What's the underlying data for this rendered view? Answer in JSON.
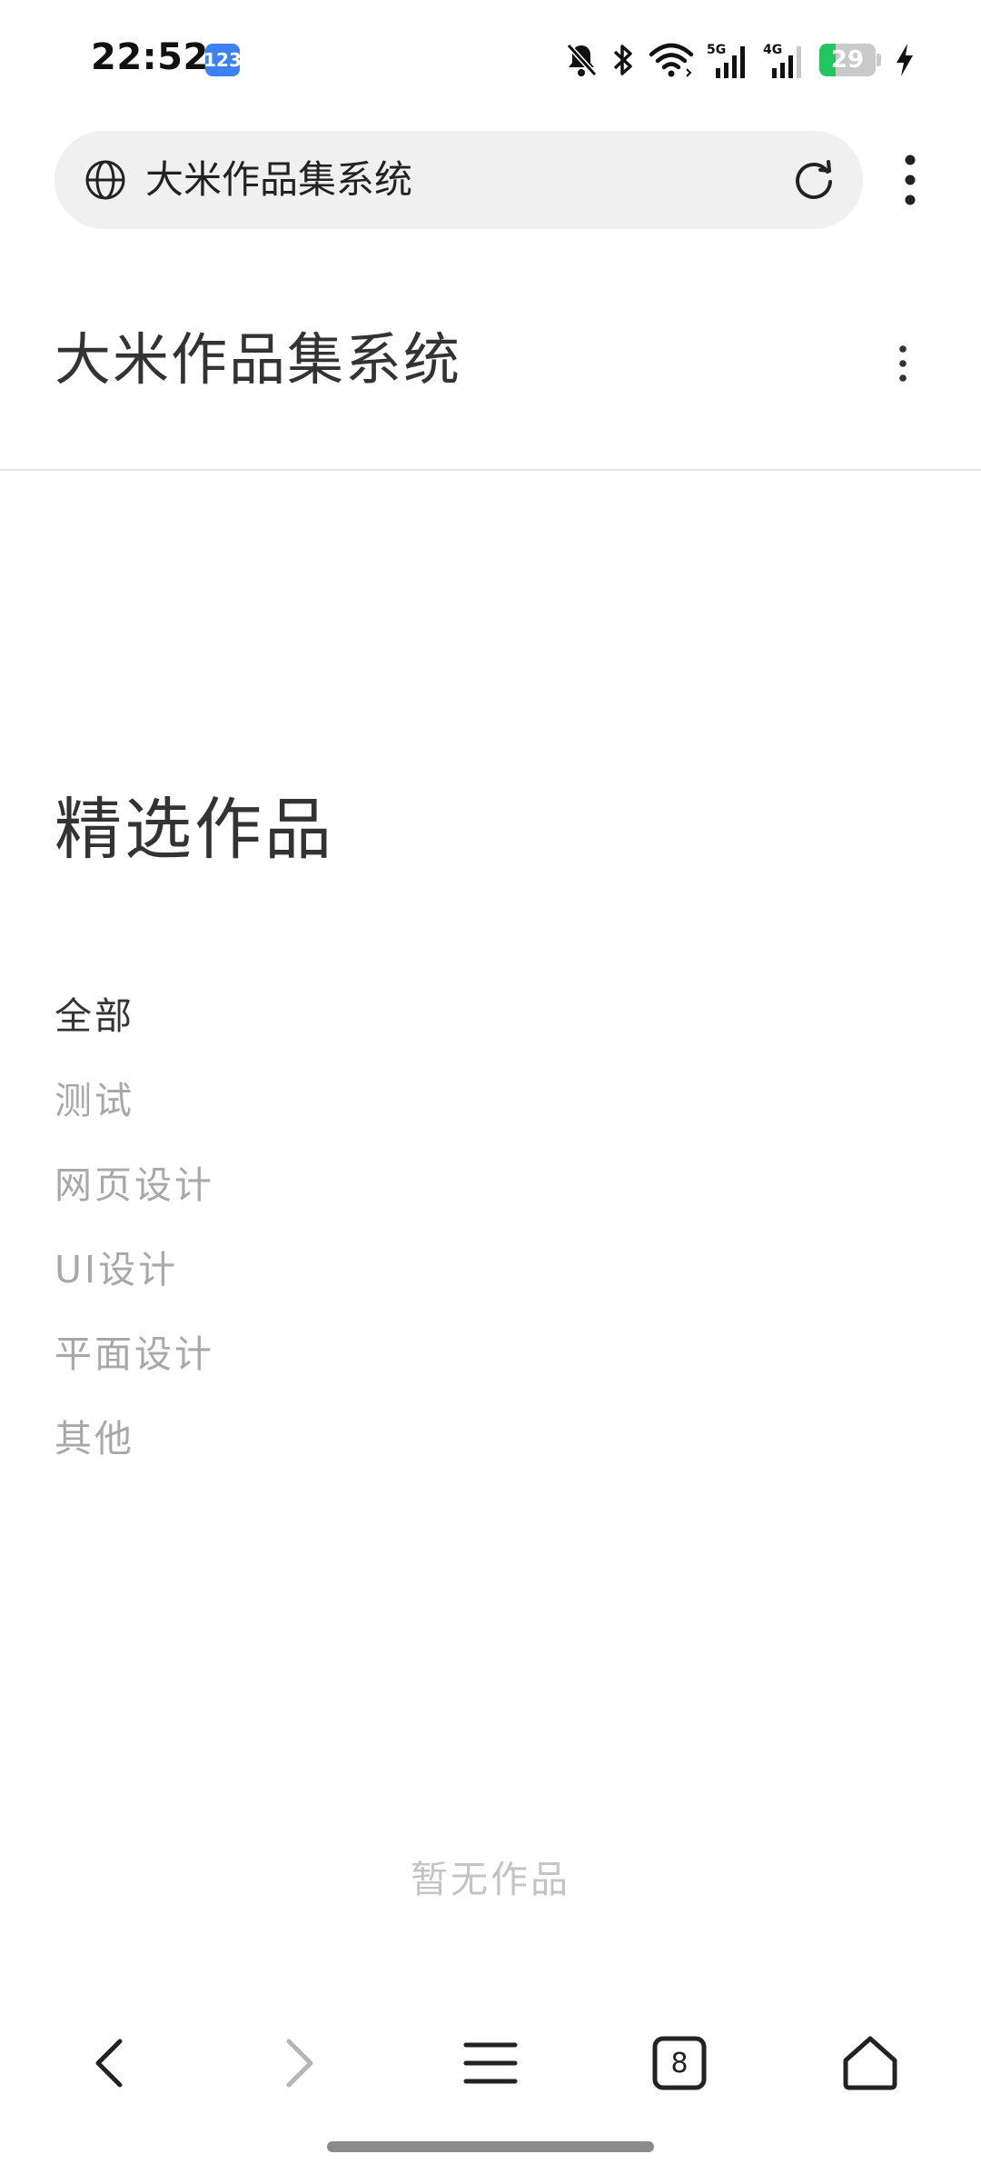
{
  "status_bar": {
    "time": "22:52",
    "app_badge": "123",
    "network_5g": "5G",
    "network_4g": "4G",
    "battery_level": "29",
    "battery_percent": 29,
    "icons": [
      "bell-off-icon",
      "bluetooth-icon",
      "wifi-icon",
      "signal-5g-icon",
      "signal-4g-icon",
      "battery-icon",
      "charging-icon"
    ]
  },
  "browser": {
    "address_text": "大米作品集系统",
    "icons": [
      "globe-icon",
      "reload-icon",
      "more-vertical-icon"
    ]
  },
  "site": {
    "title": "大米作品集系统"
  },
  "main": {
    "section_title": "精选作品",
    "categories": [
      {
        "label": "全部",
        "active": true
      },
      {
        "label": "测试",
        "active": false
      },
      {
        "label": "网页设计",
        "active": false
      },
      {
        "label": "UI设计",
        "active": false
      },
      {
        "label": "平面设计",
        "active": false
      },
      {
        "label": "其他",
        "active": false
      }
    ],
    "empty_text": "暂无作品"
  },
  "bottom_nav": {
    "tab_count": "8",
    "icons": [
      "back-icon",
      "forward-icon",
      "menu-icon",
      "tabs-icon",
      "home-icon"
    ]
  },
  "colors": {
    "accent_battery": "#22c55e",
    "badge_blue": "#3b82f6",
    "text_primary": "#333333",
    "text_inactive": "#a8a8a8",
    "text_empty": "#c4c4c4"
  }
}
